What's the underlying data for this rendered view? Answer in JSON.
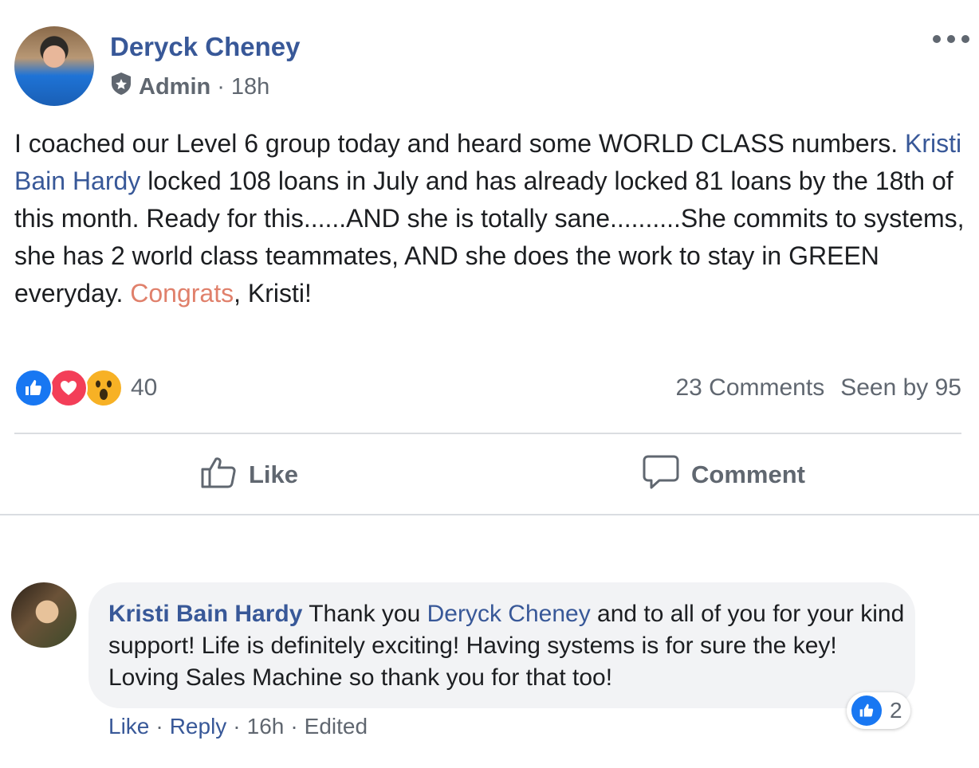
{
  "post": {
    "author": "Deryck Cheney",
    "role": "Admin",
    "separator": "·",
    "time": "18h",
    "text": {
      "p1": "I coached our Level 6 group today and heard some WORLD CLASS numbers. ",
      "mention": "Kristi Bain Hardy",
      "p2": " locked 108 loans in July and has already locked 81 loans by the 18th of this month. Ready for this......AND she is totally sane..........She commits to systems, she has 2 world class teammates, AND she does the work to stay in GREEN everyday. ",
      "highlight": "Congrats",
      "p3": ", Kristi!"
    },
    "reactions": {
      "icons": [
        "like-icon",
        "love-icon",
        "wow-icon"
      ],
      "count": "40"
    },
    "comments_count": "23 Comments",
    "seen_by": "Seen by 95",
    "actions": {
      "like": "Like",
      "comment": "Comment"
    }
  },
  "comment": {
    "author": "Kristi Bain Hardy",
    "text_a": " Thank you ",
    "mention": "Deryck Cheney",
    "text_b": " and to all of you for your kind support! Life is definitely exciting! Having systems is for sure the key! Loving Sales Machine so thank you for that too!",
    "reaction_count": "2",
    "footer": {
      "like": "Like",
      "reply": "Reply",
      "time": "16h",
      "edited": "Edited",
      "separator": "·"
    }
  },
  "colors": {
    "link": "#385898",
    "meta": "#606770",
    "highlight": "#e0806b",
    "like_blue": "#1877f2",
    "love_red": "#f33e58",
    "wow_yellow": "#f7b125"
  }
}
